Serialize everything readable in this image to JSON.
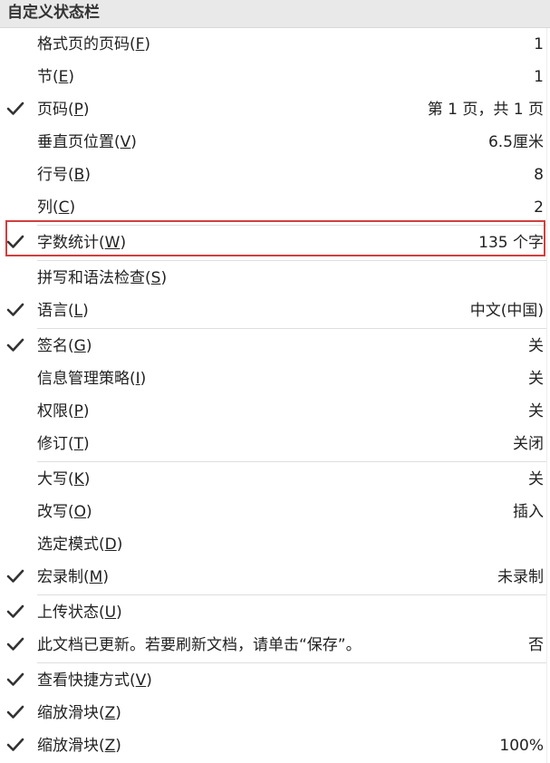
{
  "menu": {
    "title": "自定义状态栏",
    "accent_color": "#d13f3f",
    "items": [
      {
        "label": "格式页的页码(",
        "key": "F",
        "close": ")",
        "value": "1",
        "checked": false
      },
      {
        "label": "节(",
        "key": "E",
        "close": ")",
        "value": "1",
        "checked": false
      },
      {
        "label": "页码(",
        "key": "P",
        "close": ")",
        "value": "第 1 页，共 1 页",
        "checked": true
      },
      {
        "label": "垂直页位置(",
        "key": "V",
        "close": ")",
        "value": "6.5厘米",
        "checked": false
      },
      {
        "label": "行号(",
        "key": "B",
        "close": ")",
        "value": "8",
        "checked": false
      },
      {
        "label": "列(",
        "key": "C",
        "close": ")",
        "value": "2",
        "checked": false
      },
      {
        "label": "字数统计(",
        "key": "W",
        "close": ")",
        "value": "135 个字",
        "checked": true,
        "highlighted": true
      },
      {
        "label": "拼写和语法检查(",
        "key": "S",
        "close": ")",
        "value": "",
        "checked": false
      },
      {
        "label": "语言(",
        "key": "L",
        "close": ")",
        "value": "中文(中国)",
        "checked": true
      },
      {
        "label": "签名(",
        "key": "G",
        "close": ")",
        "value": "关",
        "checked": true
      },
      {
        "label": "信息管理策略(",
        "key": "I",
        "close": ")",
        "value": "关",
        "checked": false
      },
      {
        "label": "权限(",
        "key": "P",
        "close": ")",
        "value": "关",
        "checked": false
      },
      {
        "label": "修订(",
        "key": "T",
        "close": ")",
        "value": "关闭",
        "checked": false
      },
      {
        "label": "大写(",
        "key": "K",
        "close": ")",
        "value": "关",
        "checked": false
      },
      {
        "label": "改写(",
        "key": "O",
        "close": ")",
        "value": "插入",
        "checked": false
      },
      {
        "label": "选定模式(",
        "key": "D",
        "close": ")",
        "value": "",
        "checked": false
      },
      {
        "label": "宏录制(",
        "key": "M",
        "close": ")",
        "value": "未录制",
        "checked": true
      },
      {
        "label": "上传状态(",
        "key": "U",
        "close": ")",
        "value": "",
        "checked": true
      },
      {
        "label": "此文档已更新。若要刷新文档，请单击“保存”。",
        "key": "",
        "close": "",
        "value": "否",
        "checked": true
      },
      {
        "label": "查看快捷方式(",
        "key": "V",
        "close": ")",
        "value": "",
        "checked": true
      },
      {
        "label": "缩放滑块(",
        "key": "Z",
        "close": ")",
        "value": "",
        "checked": true
      },
      {
        "label": "缩放滑块(",
        "key": "Z",
        "close": ")",
        "value": "100%",
        "checked": true
      }
    ]
  }
}
